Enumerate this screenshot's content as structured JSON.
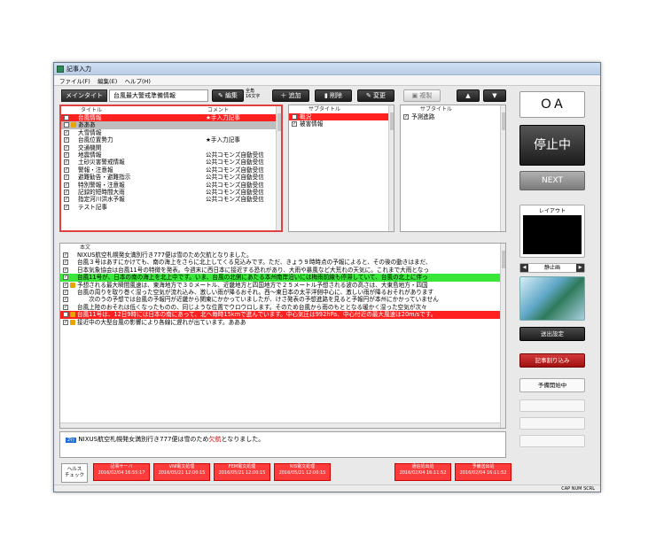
{
  "window": {
    "title": "記事入力"
  },
  "menu": [
    "ファイル(F)",
    "編集(E)",
    "ヘルプ(H)"
  ],
  "toolbar": {
    "main_title_label": "メインタイトル",
    "main_title_value": "台風最大警戒準備情報",
    "edit": "編集",
    "fullwidth_note": "全角\n16文字",
    "add": "追加",
    "delete": "削除",
    "change": "変更",
    "copy": "複製",
    "up_arrow": "▲",
    "down_arrow": "▼"
  },
  "title_panel": {
    "col_title": "タイトル",
    "col_comment": "コメント",
    "rows": [
      {
        "title": "台風情報",
        "comment": "★手入力記事",
        "checked": true,
        "lock": false,
        "style": "red"
      },
      {
        "title": "あああ",
        "comment": "",
        "checked": false,
        "lock": true,
        "style": "gray"
      },
      {
        "title": "大雪情報",
        "comment": "",
        "checked": true,
        "lock": false,
        "style": ""
      },
      {
        "title": "台風位置勢力",
        "comment": "★手入力記事",
        "checked": true,
        "lock": false,
        "style": ""
      },
      {
        "title": "交通機関",
        "comment": "",
        "checked": true,
        "lock": false,
        "style": ""
      },
      {
        "title": "地震情報",
        "comment": "公共コモンズ自動受信",
        "checked": true,
        "lock": false,
        "style": ""
      },
      {
        "title": "土砂災害警戒情報",
        "comment": "公共コモンズ自動受信",
        "checked": true,
        "lock": false,
        "style": ""
      },
      {
        "title": "警報・注意報",
        "comment": "公共コモンズ自動受信",
        "checked": true,
        "lock": false,
        "style": ""
      },
      {
        "title": "避難勧告・避難指示",
        "comment": "公共コモンズ自動受信",
        "checked": true,
        "lock": false,
        "style": ""
      },
      {
        "title": "特別警報・注意報",
        "comment": "公共コモンズ自動受信",
        "checked": true,
        "lock": false,
        "style": ""
      },
      {
        "title": "記録的短時間大雨",
        "comment": "公共コモンズ自動受信",
        "checked": true,
        "lock": false,
        "style": ""
      },
      {
        "title": "指定河川洪水予報",
        "comment": "公共コモンズ自動受信",
        "checked": true,
        "lock": false,
        "style": ""
      },
      {
        "title": "テスト記事",
        "comment": "",
        "checked": true,
        "lock": false,
        "style": ""
      }
    ]
  },
  "subtitle_panel1": {
    "col": "サブタイトル",
    "rows": [
      {
        "text": "概況",
        "checked": true,
        "style": "red"
      },
      {
        "text": "被害情報",
        "checked": true,
        "style": ""
      }
    ]
  },
  "subtitle_panel2": {
    "col": "サブタイトル",
    "rows": [
      {
        "text": "予測進路",
        "checked": true,
        "style": ""
      }
    ]
  },
  "body_panel": {
    "header": "本文",
    "rows": [
      {
        "text": "NIXUS航空札幌発女満別行き777便は雪のため欠航となりました。",
        "lock": false,
        "style": ""
      },
      {
        "text": "台風３号はあすにかけても、南の海上をさらに北上してくる見込みです。ただ、きょう９時時点の予報によると、その後の動きはまだ、",
        "lock": false,
        "style": ""
      },
      {
        "text": "日本気象協会は台風11号の特徴を発表。今週末に西日本に接近する恐れがあり、大雨や暴風など大荒れの天気に。これまで大雨となっ",
        "lock": false,
        "style": ""
      },
      {
        "text": "台風11号が、日本の南の海上を北上中です。いま、台風の北側にあたる本州南岸沿いには梅雨前線も停滞していて、台風の北上に伴っ",
        "lock": false,
        "style": "green"
      },
      {
        "text": "予想される最大瞬間風速は、東海地方で３０メートル、近畿地方と四国地方で２５メートル予想される波の高さは、大東島地方・四国",
        "lock": true,
        "style": ""
      },
      {
        "text": "台風の周りを取り巻く湿った空気が流れ込み、激しい雨が降るおそれ。西〜東日本の太平洋側中心に、激しい雨が降るおそれがあります",
        "lock": false,
        "style": ""
      },
      {
        "text": "　　次のうの予想では台風の予報円が近畿から関東にかかっていましたが、けさ発表の予想進路を見ると予報円が本州にかかっていません",
        "lock": false,
        "style": ""
      },
      {
        "text": "台風上陸のおそれは低くなったものの、同じような位置でウロウロします。そのため台風から雨のもととなる暖かく湿った空気が次々",
        "lock": false,
        "style": ""
      },
      {
        "text": "台風11号は、12日9時には日本の南にあって、北へ毎時15kmで進んでいます。中心気圧は992hPa、中心付近の最大風速は20m/sです。",
        "lock": true,
        "style": "red"
      },
      {
        "text": "接近中の大型台風の影響により各線に遅れが出ています。あああ",
        "lock": true,
        "style": ""
      }
    ]
  },
  "preview": {
    "badge": "2行",
    "text_before": "NIXUS航空札幌発女満別行き777便は雪のため",
    "text_highlight": "欠航",
    "text_after": "となりました。"
  },
  "side": {
    "oa": "ＯＡ",
    "stop": "停止中",
    "next": "NEXT",
    "layout": "レイアウト",
    "still": "静止画",
    "send_setting": "送出設定",
    "interrupt": "記事割り込み",
    "standby": "予備開始中"
  },
  "health": {
    "label": "ヘルス\nチェック",
    "cells": [
      {
        "name": "記事サーバ",
        "time": "2016/02/04 16:55:17"
      },
      {
        "name": "VNI電文処理",
        "time": "2016/05/21 12:00:15"
      },
      {
        "name": "FEM電文処理",
        "time": "2016/05/21 12:00:15"
      },
      {
        "name": "NIS電文処理",
        "time": "2016/05/21 12:00:15"
      },
      {
        "name": "通信処出処",
        "time": "2016/02/04 16:11:52"
      },
      {
        "name": "予備送出処",
        "time": "2016/02/04 16:11:52"
      }
    ]
  },
  "statusbar": {
    "keys": "CAP NUM SCRL"
  },
  "colors": {
    "red": "#ff2020",
    "green": "#39e639",
    "dark_button": "#2a2a2a"
  }
}
